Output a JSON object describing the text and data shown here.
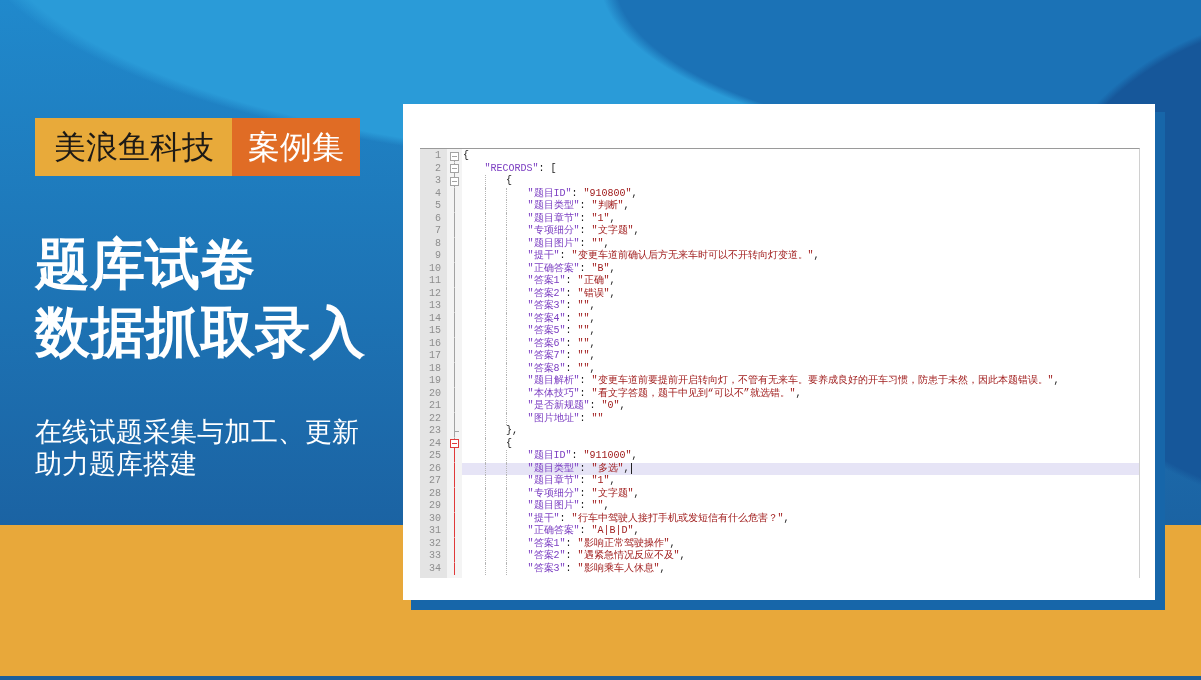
{
  "badge": {
    "brand": "美浪鱼科技",
    "tag": "案例集"
  },
  "headline": [
    "题库试卷",
    "数据抓取录入"
  ],
  "subtitle": [
    "在线试题采集与加工、更新",
    "助力题库搭建"
  ],
  "editor": {
    "lines": [
      {
        "number": "1",
        "text": "{",
        "current": false,
        "children": [
          {
            "number": "2",
            "text": "\"RECORDS\": [",
            "current": false,
            "children": [
              {
                "number": "3",
                "text": "{",
                "current": false,
                "children": [
                  {
                    "number": "4",
                    "text": "\"题目ID\": \"910800\",",
                    "current": false
                  },
                  {
                    "number": "5",
                    "text": "\"题目类型\": \"判断\",",
                    "current": false
                  },
                  {
                    "number": "6",
                    "text": "\"题目章节\": \"1\",",
                    "current": false
                  },
                  {
                    "number": "7",
                    "text": "\"专项细分\": \"文字题\",",
                    "current": false
                  },
                  {
                    "number": "8",
                    "text": "\"题目图片\": \"\",",
                    "current": false
                  },
                  {
                    "number": "9",
                    "text": "\"提干\": \"变更车道前确认后方无来车时可以不开转向灯变道。\",",
                    "current": false
                  },
                  {
                    "number": "10",
                    "text": "\"正确答案\": \"B\",",
                    "current": false
                  },
                  {
                    "number": "11",
                    "text": "\"答案1\": \"正确\",",
                    "current": false
                  },
                  {
                    "number": "12",
                    "text": "\"答案2\": \"错误\",",
                    "current": false
                  },
                  {
                    "number": "13",
                    "text": "\"答案3\": \"\",",
                    "current": false
                  },
                  {
                    "number": "14",
                    "text": "\"答案4\": \"\",",
                    "current": false
                  },
                  {
                    "number": "15",
                    "text": "\"答案5\": \"\",",
                    "current": false
                  },
                  {
                    "number": "16",
                    "text": "\"答案6\": \"\",",
                    "current": false
                  },
                  {
                    "number": "17",
                    "text": "\"答案7\": \"\",",
                    "current": false
                  },
                  {
                    "number": "18",
                    "text": "\"答案8\": \"\",",
                    "current": false
                  },
                  {
                    "number": "19",
                    "text": "\"题目解析\": \"变更车道前要提前开启转向灯，不管有无来车。要养成良好的开车习惯，防患于未然，因此本题错误。\",",
                    "current": false
                  },
                  {
                    "number": "20",
                    "text": "\"本体技巧\": \"看文字答题，题干中见到“可以不”就选错。\",",
                    "current": false
                  },
                  {
                    "number": "21",
                    "text": "\"是否新规题\": \"0\",",
                    "current": false
                  },
                  {
                    "number": "22",
                    "text": "\"图片地址\": \"\"",
                    "current": false
                  }
                ]
              },
              {
                "number": "23",
                "text": "},",
                "current": false
              },
              {
                "number": "24",
                "text": "{",
                "current": false,
                "children": [
                  {
                    "number": "25",
                    "text": "\"题目ID\": \"911000\",",
                    "current": false
                  },
                  {
                    "number": "26",
                    "text": "\"题目类型\": \"多选\",",
                    "current": true
                  },
                  {
                    "number": "27",
                    "text": "\"题目章节\": \"1\",",
                    "current": false
                  },
                  {
                    "number": "28",
                    "text": "\"专项细分\": \"文字题\",",
                    "current": false
                  },
                  {
                    "number": "29",
                    "text": "\"题目图片\": \"\",",
                    "current": false
                  },
                  {
                    "number": "30",
                    "text": "\"提干\": \"行车中驾驶人接打手机或发短信有什么危害？\",",
                    "current": false
                  },
                  {
                    "number": "31",
                    "text": "\"正确答案\": \"A|B|D\",",
                    "current": false
                  },
                  {
                    "number": "32",
                    "text": "\"答案1\": \"影响正常驾驶操作\",",
                    "current": false
                  },
                  {
                    "number": "33",
                    "text": "\"答案2\": \"遇紧急情况反应不及\",",
                    "current": false
                  },
                  {
                    "number": "34",
                    "text": "\"答案3\": \"影响乘车人休息\",",
                    "current": false
                  }
                ]
              }
            ]
          }
        ]
      }
    ]
  }
}
